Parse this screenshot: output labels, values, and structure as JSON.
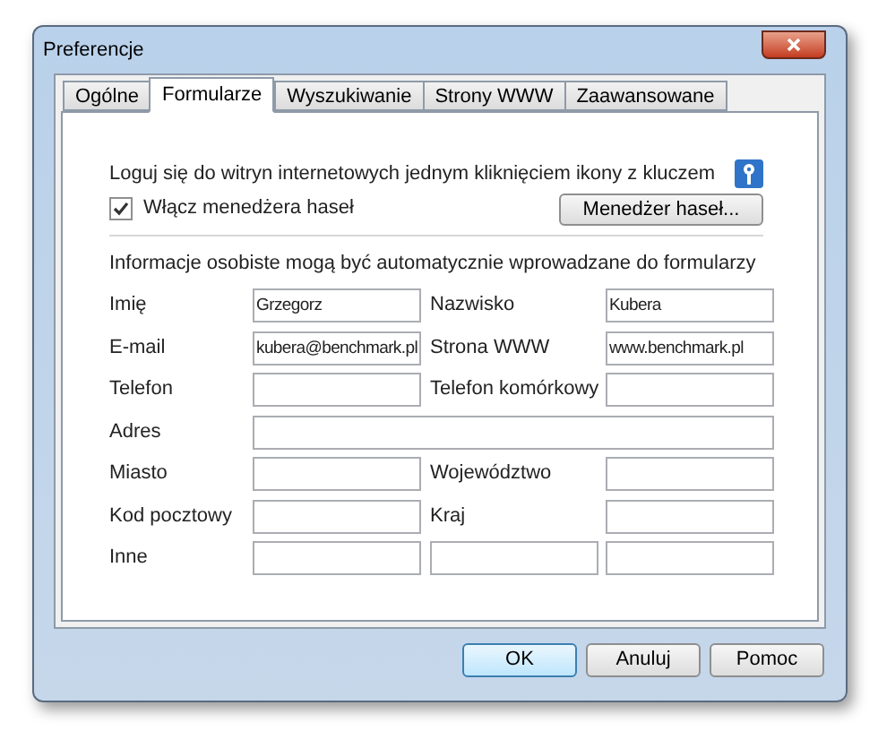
{
  "window": {
    "title": "Preferencje"
  },
  "tabs": [
    {
      "label": "Ogólne",
      "selected": false
    },
    {
      "label": "Formularze",
      "selected": true
    },
    {
      "label": "Wyszukiwanie",
      "selected": false
    },
    {
      "label": "Strony WWW",
      "selected": false
    },
    {
      "label": "Zaawansowane",
      "selected": false
    }
  ],
  "password_section": {
    "description": "Loguj się do witryn internetowych jednym kliknięciem ikony z kluczem",
    "checkbox": {
      "label": "Włącz menedżera haseł",
      "checked": true
    },
    "button": "Menedżer haseł..."
  },
  "personal_section": {
    "description": "Informacje osobiste mogą być automatycznie wprowadzane do formularzy",
    "rows": [
      {
        "cells": [
          {
            "kind": "label",
            "text": "Imię"
          },
          {
            "kind": "field",
            "value": "Grzegorz"
          },
          {
            "kind": "label",
            "text": "Nazwisko"
          },
          {
            "kind": "field",
            "value": "Kubera"
          }
        ]
      },
      {
        "cells": [
          {
            "kind": "label",
            "text": "E-mail"
          },
          {
            "kind": "field",
            "value": "kubera@benchmark.pl"
          },
          {
            "kind": "label",
            "text": "Strona WWW"
          },
          {
            "kind": "field",
            "value": "www.benchmark.pl"
          }
        ]
      },
      {
        "cells": [
          {
            "kind": "label",
            "text": "Telefon"
          },
          {
            "kind": "field"
          },
          {
            "kind": "label",
            "text": "Telefon komórkowy"
          },
          {
            "kind": "field"
          }
        ]
      },
      {
        "cells": [
          {
            "kind": "label",
            "text": "Adres"
          },
          {
            "kind": "wide_field"
          }
        ]
      },
      {
        "cells": [
          {
            "kind": "label",
            "text": "Miasto"
          },
          {
            "kind": "field"
          },
          {
            "kind": "label",
            "text": "Województwo"
          },
          {
            "kind": "field"
          }
        ]
      },
      {
        "cells": [
          {
            "kind": "label",
            "text": "Kod pocztowy"
          },
          {
            "kind": "field"
          },
          {
            "kind": "label",
            "text": "Kraj"
          },
          {
            "kind": "field"
          }
        ]
      },
      {
        "cells": [
          {
            "kind": "label",
            "text": "Inne"
          },
          {
            "kind": "field"
          },
          {
            "kind": "field"
          },
          {
            "kind": "field"
          }
        ]
      }
    ]
  },
  "buttons": [
    {
      "label": "OK",
      "default": true
    },
    {
      "label": "Anuluj",
      "default": false
    },
    {
      "label": "Pomoc",
      "default": false
    }
  ]
}
